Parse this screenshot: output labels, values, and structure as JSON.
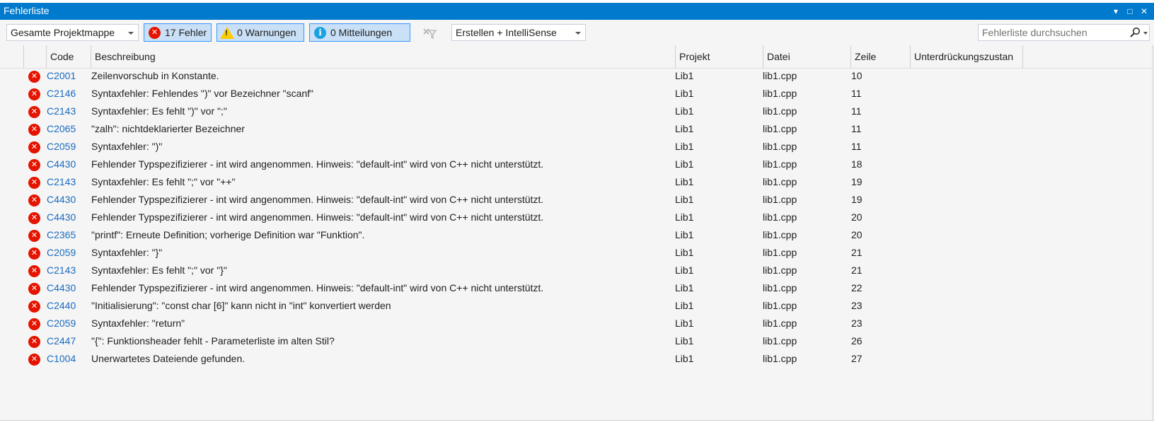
{
  "window": {
    "title": "Fehlerliste",
    "controls": [
      "▾",
      "□",
      "✕"
    ]
  },
  "toolbar": {
    "scope": "Gesamte Projektmappe",
    "errors": "17 Fehler",
    "warnings": "0 Warnungen",
    "messages": "0 Mitteilungen",
    "build_filter": "Erstellen + IntelliSense",
    "search_placeholder": "Fehlerliste durchsuchen"
  },
  "columns": [
    "Code",
    "Beschreibung",
    "Projekt",
    "Datei",
    "Zeile",
    "Unterdrückungszustan"
  ],
  "rows": [
    {
      "code": "C2001",
      "desc": "Zeilenvorschub in Konstante.",
      "project": "Lib1",
      "file": "lib1.cpp",
      "line": "10"
    },
    {
      "code": "C2146",
      "desc": "Syntaxfehler: Fehlendes \")\" vor Bezeichner \"scanf\"",
      "project": "Lib1",
      "file": "lib1.cpp",
      "line": "11"
    },
    {
      "code": "C2143",
      "desc": "Syntaxfehler: Es fehlt \")\" vor \";\"",
      "project": "Lib1",
      "file": "lib1.cpp",
      "line": "11"
    },
    {
      "code": "C2065",
      "desc": "\"zalh\": nichtdeklarierter Bezeichner",
      "project": "Lib1",
      "file": "lib1.cpp",
      "line": "11"
    },
    {
      "code": "C2059",
      "desc": "Syntaxfehler: \")\"",
      "project": "Lib1",
      "file": "lib1.cpp",
      "line": "11"
    },
    {
      "code": "C4430",
      "desc": "Fehlender Typspezifizierer - int wird angenommen. Hinweis: \"default-int\" wird von C++ nicht unterstützt.",
      "project": "Lib1",
      "file": "lib1.cpp",
      "line": "18"
    },
    {
      "code": "C2143",
      "desc": "Syntaxfehler: Es fehlt \";\" vor \"++\"",
      "project": "Lib1",
      "file": "lib1.cpp",
      "line": "19"
    },
    {
      "code": "C4430",
      "desc": "Fehlender Typspezifizierer - int wird angenommen. Hinweis: \"default-int\" wird von C++ nicht unterstützt.",
      "project": "Lib1",
      "file": "lib1.cpp",
      "line": "19"
    },
    {
      "code": "C4430",
      "desc": "Fehlender Typspezifizierer - int wird angenommen. Hinweis: \"default-int\" wird von C++ nicht unterstützt.",
      "project": "Lib1",
      "file": "lib1.cpp",
      "line": "20"
    },
    {
      "code": "C2365",
      "desc": "\"printf\": Erneute Definition; vorherige Definition war \"Funktion\".",
      "project": "Lib1",
      "file": "lib1.cpp",
      "line": "20"
    },
    {
      "code": "C2059",
      "desc": "Syntaxfehler: \"}\"",
      "project": "Lib1",
      "file": "lib1.cpp",
      "line": "21"
    },
    {
      "code": "C2143",
      "desc": "Syntaxfehler: Es fehlt \";\" vor \"}\"",
      "project": "Lib1",
      "file": "lib1.cpp",
      "line": "21"
    },
    {
      "code": "C4430",
      "desc": "Fehlender Typspezifizierer - int wird angenommen. Hinweis: \"default-int\" wird von C++ nicht unterstützt.",
      "project": "Lib1",
      "file": "lib1.cpp",
      "line": "22"
    },
    {
      "code": "C2440",
      "desc": "\"Initialisierung\": \"const char [6]\" kann nicht in \"int\" konvertiert werden",
      "project": "Lib1",
      "file": "lib1.cpp",
      "line": "23"
    },
    {
      "code": "C2059",
      "desc": "Syntaxfehler: \"return\"",
      "project": "Lib1",
      "file": "lib1.cpp",
      "line": "23"
    },
    {
      "code": "C2447",
      "desc": "\"{\": Funktionsheader fehlt - Parameterliste im alten Stil?",
      "project": "Lib1",
      "file": "lib1.cpp",
      "line": "26"
    },
    {
      "code": "C1004",
      "desc": "Unerwartetes Dateiende gefunden.",
      "project": "Lib1",
      "file": "lib1.cpp",
      "line": "27"
    }
  ],
  "colors": {
    "accent": "#007acc",
    "error": "#e51400",
    "warning": "#ffcc00",
    "info": "#1ba1e2",
    "link": "#1a6bbf"
  }
}
